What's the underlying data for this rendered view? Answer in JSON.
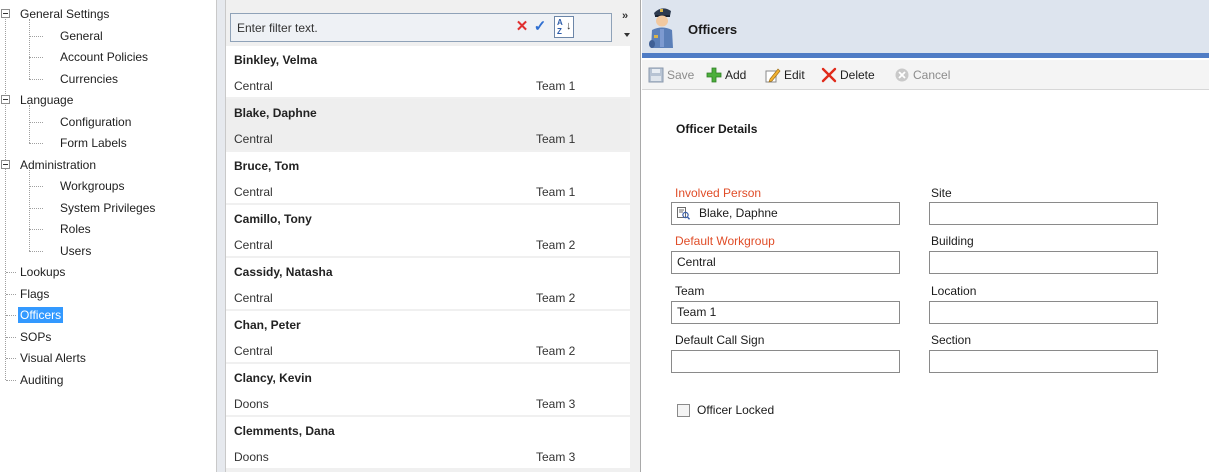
{
  "tree": {
    "items": [
      {
        "label": "General Settings",
        "level": 0,
        "expanded": true
      },
      {
        "label": "General",
        "level": 1
      },
      {
        "label": "Account Policies",
        "level": 1
      },
      {
        "label": "Currencies",
        "level": 1
      },
      {
        "label": "Language",
        "level": 0,
        "expanded": true
      },
      {
        "label": "Configuration",
        "level": 1
      },
      {
        "label": "Form Labels",
        "level": 1
      },
      {
        "label": "Administration",
        "level": 0,
        "expanded": true
      },
      {
        "label": "Workgroups",
        "level": 1
      },
      {
        "label": "System Privileges",
        "level": 1
      },
      {
        "label": "Roles",
        "level": 1
      },
      {
        "label": "Users",
        "level": 1
      },
      {
        "label": "Lookups",
        "level": 0
      },
      {
        "label": "Flags",
        "level": 0
      },
      {
        "label": "Officers",
        "level": 0,
        "selected": true
      },
      {
        "label": "SOPs",
        "level": 0
      },
      {
        "label": "Visual Alerts",
        "level": 0
      },
      {
        "label": "Auditing",
        "level": 0
      }
    ]
  },
  "filter": {
    "placeholder": "Enter filter text.",
    "value": "",
    "clear_icon": "clear-x-icon",
    "apply_icon": "checkmark-icon",
    "sort_icon": "sort-az-icon",
    "sort_letters": "A Z",
    "sort_arrow": "↓",
    "chevron": "»"
  },
  "officers": [
    {
      "name": "Binkley, Velma",
      "workgroup": "Central",
      "team": "Team 1"
    },
    {
      "name": "Blake, Daphne",
      "workgroup": "Central",
      "team": "Team 1",
      "selected": true
    },
    {
      "name": "Bruce, Tom",
      "workgroup": "Central",
      "team": "Team 1"
    },
    {
      "name": "Camillo, Tony",
      "workgroup": "Central",
      "team": "Team 2"
    },
    {
      "name": "Cassidy, Natasha",
      "workgroup": "Central",
      "team": "Team 2"
    },
    {
      "name": "Chan, Peter",
      "workgroup": "Central",
      "team": "Team 2"
    },
    {
      "name": "Clancy, Kevin",
      "workgroup": "Doons",
      "team": "Team 3"
    },
    {
      "name": "Clemments, Dana",
      "workgroup": "Doons",
      "team": "Team 3"
    }
  ],
  "detail": {
    "title": "Officers",
    "icon": "police-officer-icon",
    "toolbar": {
      "save": "Save",
      "add": "Add",
      "edit": "Edit",
      "delete": "Delete",
      "cancel": "Cancel"
    },
    "section_title": "Officer Details",
    "fields": {
      "involved_person_label": "Involved Person",
      "involved_person_value": "Blake, Daphne",
      "default_workgroup_label": "Default Workgroup",
      "default_workgroup_value": "Central",
      "team_label": "Team",
      "team_value": "Team 1",
      "default_call_sign_label": "Default Call Sign",
      "default_call_sign_value": "",
      "site_label": "Site",
      "site_value": "",
      "building_label": "Building",
      "building_value": "",
      "location_label": "Location",
      "location_value": "",
      "section_label": "Section",
      "section_value": ""
    },
    "officer_locked_label": "Officer Locked",
    "officer_locked": false
  },
  "colors": {
    "selection": "#3399ff",
    "required_label": "#e04d28",
    "header_accent": "#4f7cc5",
    "header_bg": "#dde4ee"
  }
}
